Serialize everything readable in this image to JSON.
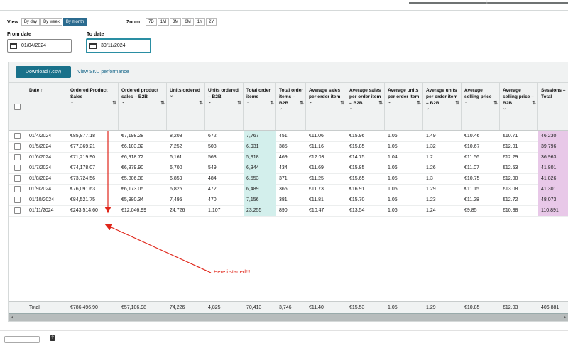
{
  "top": {
    "scroll_label": "|||"
  },
  "view": {
    "label": "View",
    "options": [
      "By day",
      "By week",
      "By month"
    ],
    "selected": "By month"
  },
  "zoom": {
    "label": "Zoom",
    "options": [
      "7D",
      "1M",
      "3M",
      "6M",
      "1Y",
      "2Y"
    ]
  },
  "from_date": {
    "label": "From date",
    "value": "01/04/2024"
  },
  "to_date": {
    "label": "To date",
    "value": "30/11/2024"
  },
  "toolbar": {
    "download_label": "Download (.csv)",
    "sku_link": "View SKU performance"
  },
  "table": {
    "headers": [
      {
        "key": "date",
        "label": "Date ↑"
      },
      {
        "key": "ops",
        "label": "Ordered Product Sales"
      },
      {
        "key": "ops_b2b",
        "label": "Ordered product sales – B2B"
      },
      {
        "key": "units",
        "label": "Units ordered"
      },
      {
        "key": "units_b2b",
        "label": "Units ordered – B2B"
      },
      {
        "key": "items",
        "label": "Total order items"
      },
      {
        "key": "items_b2b",
        "label": "Total order items – B2B"
      },
      {
        "key": "avg_sales",
        "label": "Average sales per order item"
      },
      {
        "key": "avg_sales_b2b",
        "label": "Average sales per order item – B2B"
      },
      {
        "key": "avg_units",
        "label": "Average units per order item"
      },
      {
        "key": "avg_units_b2b",
        "label": "Average units per order item – B2B"
      },
      {
        "key": "avg_price",
        "label": "Average selling price"
      },
      {
        "key": "avg_price_b2b",
        "label": "Average selling price – B2B"
      },
      {
        "key": "sessions",
        "label": "Sessions – Total"
      }
    ],
    "rows": [
      [
        "01/4/2024",
        "€85,877.18",
        "€7,198.28",
        "8,208",
        "672",
        "7,767",
        "451",
        "€11.06",
        "€15.96",
        "1.06",
        "1.49",
        "€10.46",
        "€10.71",
        "46,230"
      ],
      [
        "01/5/2024",
        "€77,369.21",
        "€6,103.32",
        "7,252",
        "508",
        "6,931",
        "385",
        "€11.16",
        "€15.85",
        "1.05",
        "1.32",
        "€10.67",
        "€12.01",
        "39,796"
      ],
      [
        "01/6/2024",
        "€71,219.90",
        "€6,918.72",
        "6,161",
        "563",
        "5,918",
        "469",
        "€12.03",
        "€14.75",
        "1.04",
        "1.2",
        "€11.56",
        "€12.29",
        "36,963"
      ],
      [
        "01/7/2024",
        "€74,178.07",
        "€6,879.90",
        "6,700",
        "549",
        "6,344",
        "434",
        "€11.69",
        "€15.85",
        "1.06",
        "1.26",
        "€11.07",
        "€12.53",
        "41,801"
      ],
      [
        "01/8/2024",
        "€73,724.56",
        "€5,806.38",
        "6,859",
        "484",
        "6,553",
        "371",
        "€11.25",
        "€15.65",
        "1.05",
        "1.3",
        "€10.75",
        "€12.00",
        "41,826"
      ],
      [
        "01/9/2024",
        "€76,091.63",
        "€6,173.05",
        "6,825",
        "472",
        "6,489",
        "365",
        "€11.73",
        "€16.91",
        "1.05",
        "1.29",
        "€11.15",
        "€13.08",
        "41,301"
      ],
      [
        "01/10/2024",
        "€84,521.75",
        "€5,980.34",
        "7,495",
        "470",
        "7,156",
        "381",
        "€11.81",
        "€15.70",
        "1.05",
        "1.23",
        "€11.28",
        "€12.72",
        "48,073"
      ],
      [
        "01/11/2024",
        "€243,514.60",
        "€12,046.99",
        "24,726",
        "1,107",
        "23,255",
        "890",
        "€10.47",
        "€13.54",
        "1.06",
        "1.24",
        "€9.85",
        "€10.88",
        "110,891"
      ]
    ],
    "total": [
      "Total",
      "€786,496.90",
      "€57,106.98",
      "74,226",
      "4,825",
      "70,413",
      "3,746",
      "€11.40",
      "€15.53",
      "1.05",
      "1.29",
      "€10.85",
      "€12.03",
      "406,881"
    ]
  },
  "annotation": {
    "text": "Here i started!!!",
    "color": "#e0261a"
  },
  "colors": {
    "accent": "#19718a",
    "selected_segment": "#2b6b8f",
    "total_items_column": "#d3efec",
    "sessions_column": "#e8c8e8"
  }
}
